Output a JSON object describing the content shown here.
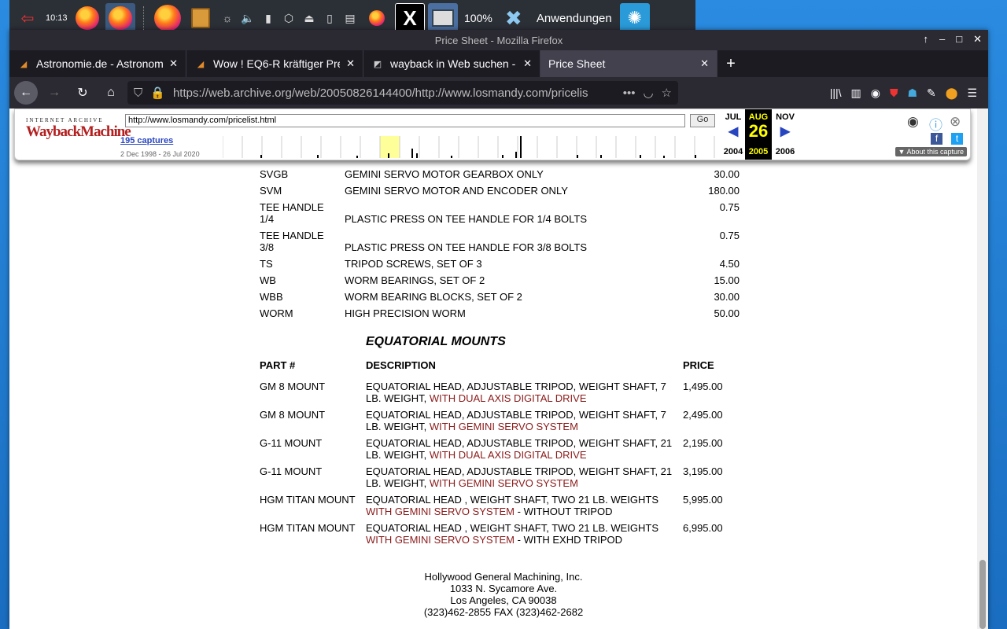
{
  "taskbar": {
    "clock": "10:13",
    "zoom": "100%",
    "apps_label": "Anwendungen"
  },
  "window": {
    "title": "Price Sheet - Mozilla Firefox"
  },
  "tabs": [
    {
      "title": "Astronomie.de - Astronom"
    },
    {
      "title": "Wow ! EQ6-R kräftiger Pre"
    },
    {
      "title": "wayback in Web suchen -"
    },
    {
      "title": "Price Sheet"
    }
  ],
  "urlbar": {
    "url": "https://web.archive.org/web/20050826144400/http://www.losmandy.com/pricelis"
  },
  "wayback": {
    "logo_top": "INTERNET ARCHIVE",
    "logo_main": "WaybackMachine",
    "url_value": "http://www.losmandy.com/pricelist.html",
    "go": "Go",
    "captures": "195 captures",
    "range": "2 Dec 1998 - 26 Jul 2020",
    "prev_month": "JUL",
    "cur_month": "AUG",
    "next_month": "NOV",
    "prev_year": "2004",
    "cur_day": "26",
    "cur_year": "2005",
    "next_year": "2006",
    "about": "About this capture"
  },
  "parts": [
    {
      "part": "SVGB",
      "desc": "GEMINI SERVO MOTOR GEARBOX ONLY",
      "price": "30.00"
    },
    {
      "part": "SVM",
      "desc": "GEMINI SERVO MOTOR AND ENCODER ONLY",
      "price": "180.00"
    },
    {
      "part": "TEE HANDLE 1/4",
      "desc": "PLASTIC PRESS ON TEE HANDLE FOR 1/4 BOLTS",
      "price": "0.75"
    },
    {
      "part": "TEE HANDLE 3/8",
      "desc": "PLASTIC PRESS ON TEE HANDLE FOR 3/8 BOLTS",
      "price": "0.75"
    },
    {
      "part": "TS",
      "desc": "TRIPOD SCREWS, SET OF 3",
      "price": "4.50"
    },
    {
      "part": "WB",
      "desc": "WORM BEARINGS, SET OF 2",
      "price": "15.00"
    },
    {
      "part": "WBB",
      "desc": "WORM BEARING BLOCKS, SET OF 2",
      "price": "30.00"
    },
    {
      "part": "WORM",
      "desc": "HIGH PRECISION WORM",
      "price": "50.00"
    }
  ],
  "mounts": {
    "heading": "EQUATORIAL MOUNTS",
    "col_part": "PART #",
    "col_desc": "DESCRIPTION",
    "col_price": "PRICE",
    "rows": [
      {
        "part": "GM 8 MOUNT",
        "desc": "EQUATORIAL HEAD, ADJUSTABLE TRIPOD, WEIGHT SHAFT, 7 LB. WEIGHT, ",
        "red": "WITH DUAL AXIS DIGITAL DRIVE",
        "tail": "",
        "price": "1,495.00"
      },
      {
        "part": "GM 8 MOUNT",
        "desc": "EQUATORIAL HEAD, ADJUSTABLE TRIPOD, WEIGHT SHAFT, 7 LB. WEIGHT, ",
        "red": "WITH GEMINI SERVO SYSTEM",
        "tail": "",
        "price": "2,495.00"
      },
      {
        "part": "G-11 MOUNT",
        "desc": "EQUATORIAL HEAD, ADJUSTABLE TRIPOD, WEIGHT SHAFT, 21 LB. WEIGHT, ",
        "red": "WITH DUAL AXIS DIGITAL DRIVE",
        "tail": "",
        "price": "2,195.00"
      },
      {
        "part": "G-11 MOUNT",
        "desc": "EQUATORIAL HEAD, ADJUSTABLE TRIPOD, WEIGHT SHAFT, 21 LB. WEIGHT, ",
        "red": "WITH GEMINI SERVO SYSTEM",
        "tail": "",
        "price": "3,195.00"
      },
      {
        "part": "HGM TITAN MOUNT",
        "desc": "EQUATORIAL HEAD , WEIGHT SHAFT, TWO 21 LB. WEIGHTS ",
        "red": "WITH GEMINI SERVO SYSTEM",
        "tail": " - WITHOUT TRIPOD",
        "price": "5,995.00"
      },
      {
        "part": "HGM TITAN MOUNT",
        "desc": "EQUATORIAL HEAD , WEIGHT SHAFT, TWO 21 LB. WEIGHTS ",
        "red": "WITH GEMINI SERVO SYSTEM",
        "tail": " - WITH EXHD TRIPOD",
        "price": "6,995.00"
      }
    ]
  },
  "address": {
    "company": "Hollywood General Machining, Inc.",
    "street": "1033 N. Sycamore Ave.",
    "city": "Los Angeles, CA 90038",
    "phone": "(323)462-2855 FAX (323)462-2682"
  },
  "colors": {
    "accent_red": "#8a1a1a",
    "wayback_red": "#b41f1f",
    "link_blue": "#2845c0"
  }
}
